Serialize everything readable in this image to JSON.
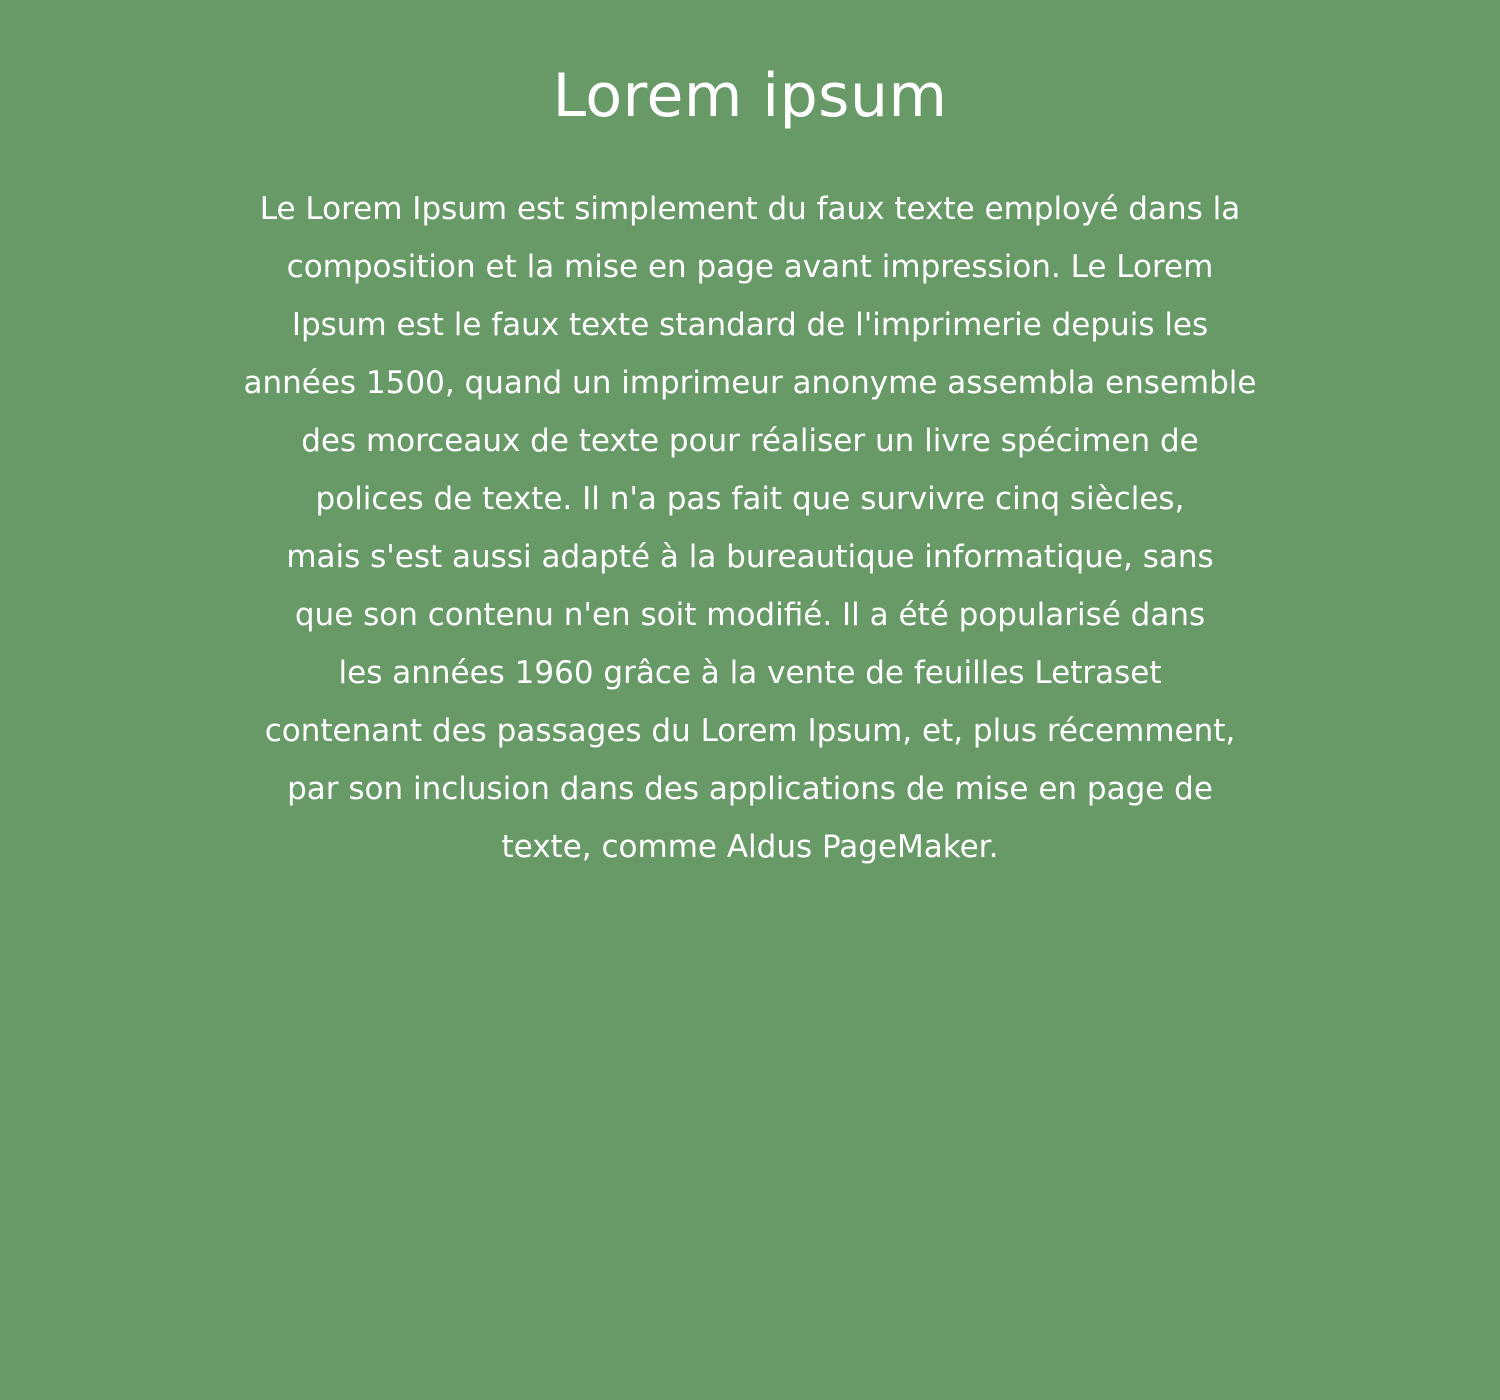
{
  "theme": {
    "background": "#689a68",
    "text_color": "#ffffff"
  },
  "heading": "Lorem ipsum",
  "paragraph_lines": [
    "Le Lorem Ipsum est simplement du faux texte employé dans la",
    "composition et la mise en page avant impression. Le Lorem",
    "Ipsum est le faux texte standard de l'imprimerie depuis les",
    "années 1500, quand un imprimeur anonyme assembla ensemble",
    "des morceaux de texte pour réaliser un livre spécimen de",
    "polices de texte. Il n'a pas fait que survivre cinq siècles,",
    "mais s'est aussi adapté à la bureautique informatique, sans",
    "que son contenu n'en soit modifié. Il a été popularisé dans",
    "les années 1960 grâce à la vente de feuilles Letraset",
    "contenant des passages du Lorem Ipsum, et, plus récemment,",
    "par son inclusion dans des applications de mise en page de",
    "texte, comme Aldus PageMaker."
  ]
}
